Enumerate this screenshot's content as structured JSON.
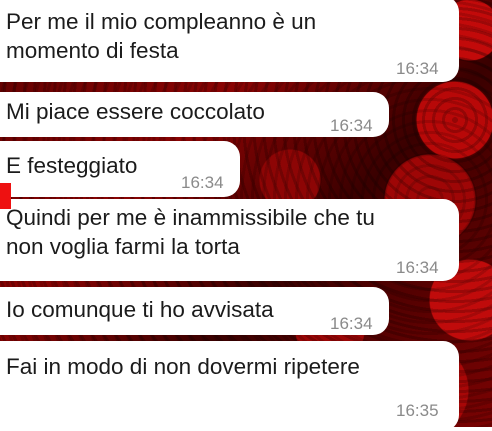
{
  "chat": {
    "messages": [
      {
        "lines": [
          "Per me il mio compleanno è un",
          "momento di festa"
        ],
        "time": "16:34"
      },
      {
        "lines": [
          "Mi piace essere coccolato"
        ],
        "time": "16:34"
      },
      {
        "lines": [
          "E festeggiato"
        ],
        "time": "16:34"
      },
      {
        "lines": [
          "Quindi per me è inammissibile che tu",
          "non voglia farmi la torta"
        ],
        "time": "16:34"
      },
      {
        "lines": [
          "Io comunque ti ho avvisata"
        ],
        "time": "16:34"
      },
      {
        "lines": [
          "Fai in modo di non dovermi ripetere"
        ],
        "time": "16:35"
      }
    ]
  },
  "colors": {
    "bubble": "#ffffff",
    "timestamp": "#8a8a8a",
    "marker": "#ee1111",
    "wallpaper": "#8a0303"
  }
}
